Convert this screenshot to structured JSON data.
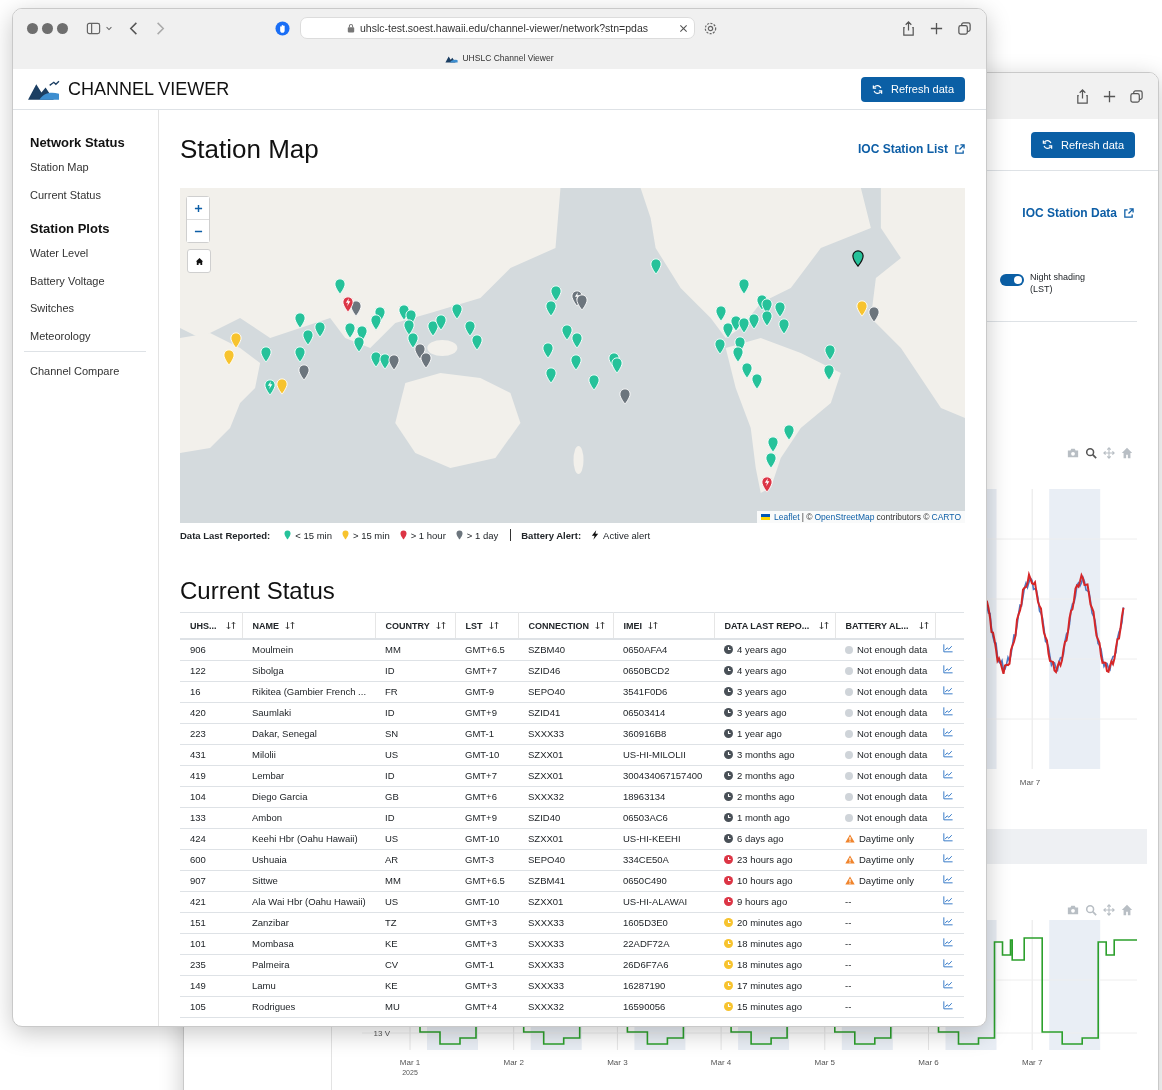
{
  "back_window": {
    "refresh_button": "Refresh data",
    "link": "IOC Station Data",
    "night_shading": {
      "label": "Night shading (LST)",
      "on": true
    },
    "chart1": {
      "xtick": "Mar 7"
    },
    "chart2": {
      "ytick": "13 V",
      "xticks": [
        "Mar 1",
        "Mar 2",
        "Mar 3",
        "Mar 4",
        "Mar 5",
        "Mar 6",
        "Mar 7"
      ],
      "year": "2025"
    }
  },
  "front_window": {
    "url": "uhslc-test.soest.hawaii.edu/channel-viewer/network?stn=pdas",
    "tab_title": "UHSLC Channel Viewer",
    "app_title": "CHANNEL VIEWER",
    "refresh_button": "Refresh data",
    "sidebar": {
      "sections": [
        {
          "heading": "Network Status",
          "items": [
            {
              "label": "Station Map",
              "selected": false
            },
            {
              "label": "Current Status",
              "selected": false
            }
          ]
        },
        {
          "heading": "Station Plots",
          "items": [
            {
              "label": "Water Level",
              "selected": false
            },
            {
              "label": "Battery Voltage",
              "selected": false
            },
            {
              "label": "Switches",
              "selected": false
            },
            {
              "label": "Meteorology",
              "selected": false
            }
          ]
        }
      ],
      "footer_items": [
        {
          "label": "Channel Compare",
          "selected": false
        }
      ]
    },
    "map_section": {
      "title": "Station Map",
      "link": "IOC Station List",
      "attribution": {
        "leaflet": "Leaflet",
        "middle": "| ©",
        "osm": "OpenStreetMap",
        "rest": "contributors ©",
        "carto": "CARTO"
      },
      "legend": {
        "title": "Data Last Reported:",
        "items": [
          {
            "label": "< 15 min",
            "color": "#26c29a"
          },
          {
            "label": "> 15 min",
            "color": "#f7c32e"
          },
          {
            "label": "> 1 hour",
            "color": "#dc3545"
          },
          {
            "label": "> 1 day",
            "color": "#6c757d"
          }
        ],
        "battery_title": "Battery Alert:",
        "battery_label": "Active alert"
      },
      "markers": [
        {
          "color": "#26c29a",
          "alert": false,
          "selected": false
        },
        {
          "color": "#26c29a",
          "alert": false,
          "selected": false
        },
        {
          "color": "#26c29a",
          "alert": false,
          "selected": false
        },
        {
          "color": "#26c29a",
          "alert": false,
          "selected": false
        },
        {
          "color": "#26c29a",
          "alert": false,
          "selected": false
        },
        {
          "color": "#26c29a",
          "alert": false,
          "selected": false
        },
        {
          "color": "#26c29a",
          "alert": false,
          "selected": false
        },
        {
          "color": "#26c29a",
          "alert": false,
          "selected": false
        },
        {
          "color": "#26c29a",
          "alert": false,
          "selected": false
        },
        {
          "color": "#26c29a",
          "alert": false,
          "selected": false
        },
        {
          "color": "#26c29a",
          "alert": false,
          "selected": false
        },
        {
          "color": "#26c29a",
          "alert": false,
          "selected": false
        },
        {
          "color": "#26c29a",
          "alert": false,
          "selected": false
        },
        {
          "color": "#26c29a",
          "alert": false,
          "selected": false
        },
        {
          "color": "#26c29a",
          "alert": false,
          "selected": false
        },
        {
          "color": "#26c29a",
          "alert": false,
          "selected": false
        },
        {
          "color": "#26c29a",
          "alert": false,
          "selected": false
        },
        {
          "color": "#26c29a",
          "alert": false,
          "selected": false
        },
        {
          "color": "#26c29a",
          "alert": false,
          "selected": false
        },
        {
          "color": "#26c29a",
          "alert": false,
          "selected": false
        },
        {
          "color": "#26c29a",
          "alert": false,
          "selected": false
        },
        {
          "color": "#26c29a",
          "alert": false,
          "selected": false
        },
        {
          "color": "#26c29a",
          "alert": true,
          "selected": false
        },
        {
          "color": "#26c29a",
          "alert": false,
          "selected": false
        },
        {
          "color": "#26c29a",
          "alert": false,
          "selected": false
        },
        {
          "color": "#26c29a",
          "alert": false,
          "selected": false
        },
        {
          "color": "#26c29a",
          "alert": false,
          "selected": false
        },
        {
          "color": "#26c29a",
          "alert": false,
          "selected": false
        },
        {
          "color": "#26c29a",
          "alert": false,
          "selected": false
        },
        {
          "color": "#26c29a",
          "alert": false,
          "selected": false
        },
        {
          "color": "#26c29a",
          "alert": false,
          "selected": false
        },
        {
          "color": "#26c29a",
          "alert": false,
          "selected": false
        },
        {
          "color": "#26c29a",
          "alert": false,
          "selected": false
        },
        {
          "color": "#26c29a",
          "alert": false,
          "selected": false
        },
        {
          "color": "#26c29a",
          "alert": false,
          "selected": false
        },
        {
          "color": "#26c29a",
          "alert": false,
          "selected": false
        },
        {
          "color": "#26c29a",
          "alert": false,
          "selected": false
        },
        {
          "color": "#26c29a",
          "alert": false,
          "selected": false
        },
        {
          "color": "#26c29a",
          "alert": false,
          "selected": false
        },
        {
          "color": "#26c29a",
          "alert": false,
          "selected": false
        },
        {
          "color": "#26c29a",
          "alert": false,
          "selected": false
        },
        {
          "color": "#26c29a",
          "alert": false,
          "selected": false
        },
        {
          "color": "#26c29a",
          "alert": false,
          "selected": false
        },
        {
          "color": "#26c29a",
          "alert": false,
          "selected": false
        },
        {
          "color": "#26c29a",
          "alert": false,
          "selected": false
        },
        {
          "color": "#26c29a",
          "alert": false,
          "selected": false
        },
        {
          "color": "#26c29a",
          "alert": false,
          "selected": false
        },
        {
          "color": "#26c29a",
          "alert": false,
          "selected": false
        },
        {
          "color": "#26c29a",
          "alert": false,
          "selected": false
        },
        {
          "color": "#26c29a",
          "alert": false,
          "selected": false
        },
        {
          "color": "#26c29a",
          "alert": false,
          "selected": false
        },
        {
          "color": "#26c29a",
          "alert": false,
          "selected": false
        },
        {
          "color": "#26c29a",
          "alert": false,
          "selected": false
        },
        {
          "color": "#26c29a",
          "alert": false,
          "selected": false
        },
        {
          "color": "#26c29a",
          "alert": false,
          "selected": false
        },
        {
          "color": "#26c29a",
          "alert": false,
          "selected": true
        },
        {
          "color": "#f7c32e",
          "alert": false,
          "selected": false
        },
        {
          "color": "#f7c32e",
          "alert": false,
          "selected": false
        },
        {
          "color": "#f7c32e",
          "alert": false,
          "selected": false
        },
        {
          "color": "#f7c32e",
          "alert": false,
          "selected": false
        },
        {
          "color": "#6c757d",
          "alert": false,
          "selected": false
        },
        {
          "color": "#6c757d",
          "alert": false,
          "selected": false
        },
        {
          "color": "#6c757d",
          "alert": false,
          "selected": false
        },
        {
          "color": "#6c757d",
          "alert": false,
          "selected": false
        },
        {
          "color": "#6c757d",
          "alert": false,
          "selected": false
        },
        {
          "color": "#6c757d",
          "alert": true,
          "selected": false
        },
        {
          "color": "#6c757d",
          "alert": false,
          "selected": false
        },
        {
          "color": "#6c757d",
          "alert": false,
          "selected": false
        },
        {
          "color": "#6c757d",
          "alert": false,
          "selected": false
        },
        {
          "color": "#dc3545",
          "alert": true,
          "selected": false
        },
        {
          "color": "#dc3545",
          "alert": true,
          "selected": false
        }
      ]
    },
    "status_section": {
      "title": "Current Status",
      "columns": [
        "UHS...",
        "NAME",
        "COUNTRY",
        "LST",
        "CONNECTION",
        "IMEI",
        "DATA LAST REPO...",
        "BATTERY AL..."
      ],
      "rows": [
        {
          "id": "906",
          "name": "Moulmein",
          "country": "MM",
          "lst": "GMT+6.5",
          "connection": "SZBM40",
          "imei": "0650AFA4",
          "last_report": "4 years ago",
          "color": "#495057",
          "battery": {
            "text": "Not enough data",
            "kind": "no_data"
          }
        },
        {
          "id": "122",
          "name": "Sibolga",
          "country": "ID",
          "lst": "GMT+7",
          "connection": "SZID46",
          "imei": "0650BCD2",
          "last_report": "4 years ago",
          "color": "#495057",
          "battery": {
            "text": "Not enough data",
            "kind": "no_data"
          }
        },
        {
          "id": "16",
          "name": "Rikitea (Gambier French ...",
          "country": "FR",
          "lst": "GMT-9",
          "connection": "SEPO40",
          "imei": "3541F0D6",
          "last_report": "3 years ago",
          "color": "#495057",
          "battery": {
            "text": "Not enough data",
            "kind": "no_data"
          }
        },
        {
          "id": "420",
          "name": "Saumlaki",
          "country": "ID",
          "lst": "GMT+9",
          "connection": "SZID41",
          "imei": "06503414",
          "last_report": "3 years ago",
          "color": "#495057",
          "battery": {
            "text": "Not enough data",
            "kind": "no_data"
          }
        },
        {
          "id": "223",
          "name": "Dakar, Senegal",
          "country": "SN",
          "lst": "GMT-1",
          "connection": "SXXX33",
          "imei": "360916B8",
          "last_report": "1 year ago",
          "color": "#495057",
          "battery": {
            "text": "Not enough data",
            "kind": "no_data"
          }
        },
        {
          "id": "431",
          "name": "Milolii",
          "country": "US",
          "lst": "GMT-10",
          "connection": "SZXX01",
          "imei": "US-HI-MILOLII",
          "last_report": "3 months ago",
          "color": "#495057",
          "battery": {
            "text": "Not enough data",
            "kind": "no_data"
          }
        },
        {
          "id": "419",
          "name": "Lembar",
          "country": "ID",
          "lst": "GMT+7",
          "connection": "SZXX01",
          "imei": "300434067157400",
          "last_report": "2 months ago",
          "color": "#495057",
          "battery": {
            "text": "Not enough data",
            "kind": "no_data"
          }
        },
        {
          "id": "104",
          "name": "Diego Garcia",
          "country": "GB",
          "lst": "GMT+6",
          "connection": "SXXX32",
          "imei": "18963134",
          "last_report": "2 months ago",
          "color": "#495057",
          "battery": {
            "text": "Not enough data",
            "kind": "no_data"
          }
        },
        {
          "id": "133",
          "name": "Ambon",
          "country": "ID",
          "lst": "GMT+9",
          "connection": "SZID40",
          "imei": "06503AC6",
          "last_report": "1 month ago",
          "color": "#495057",
          "battery": {
            "text": "Not enough data",
            "kind": "no_data"
          }
        },
        {
          "id": "424",
          "name": "Keehi Hbr (Oahu Hawaii)",
          "country": "US",
          "lst": "GMT-10",
          "connection": "SZXX01",
          "imei": "US-HI-KEEHI",
          "last_report": "6 days ago",
          "color": "#495057",
          "battery": {
            "text": "Daytime only",
            "kind": "warning"
          }
        },
        {
          "id": "600",
          "name": "Ushuaia",
          "country": "AR",
          "lst": "GMT-3",
          "connection": "SEPO40",
          "imei": "334CE50A",
          "last_report": "23 hours ago",
          "color": "#dc3545",
          "battery": {
            "text": "Daytime only",
            "kind": "warning"
          }
        },
        {
          "id": "907",
          "name": "Sittwe",
          "country": "MM",
          "lst": "GMT+6.5",
          "connection": "SZBM41",
          "imei": "0650C490",
          "last_report": "10 hours ago",
          "color": "#dc3545",
          "battery": {
            "text": "Daytime only",
            "kind": "warning"
          }
        },
        {
          "id": "421",
          "name": "Ala Wai Hbr (Oahu Hawaii)",
          "country": "US",
          "lst": "GMT-10",
          "connection": "SZXX01",
          "imei": "US-HI-ALAWAI",
          "last_report": "9 hours ago",
          "color": "#dc3545",
          "battery": {
            "text": "--",
            "kind": "none"
          }
        },
        {
          "id": "151",
          "name": "Zanzibar",
          "country": "TZ",
          "lst": "GMT+3",
          "connection": "SXXX33",
          "imei": "1605D3E0",
          "last_report": "20 minutes ago",
          "color": "#f7c32e",
          "battery": {
            "text": "--",
            "kind": "none"
          }
        },
        {
          "id": "101",
          "name": "Mombasa",
          "country": "KE",
          "lst": "GMT+3",
          "connection": "SXXX33",
          "imei": "22ADF72A",
          "last_report": "18 minutes ago",
          "color": "#f7c32e",
          "battery": {
            "text": "--",
            "kind": "none"
          }
        },
        {
          "id": "235",
          "name": "Palmeira",
          "country": "CV",
          "lst": "GMT-1",
          "connection": "SXXX33",
          "imei": "26D6F7A6",
          "last_report": "18 minutes ago",
          "color": "#f7c32e",
          "battery": {
            "text": "--",
            "kind": "none"
          }
        },
        {
          "id": "149",
          "name": "Lamu",
          "country": "KE",
          "lst": "GMT+3",
          "connection": "SXXX33",
          "imei": "16287190",
          "last_report": "17 minutes ago",
          "color": "#f7c32e",
          "battery": {
            "text": "--",
            "kind": "none"
          }
        },
        {
          "id": "105",
          "name": "Rodrigues",
          "country": "MU",
          "lst": "GMT+4",
          "connection": "SXXX32",
          "imei": "16590056",
          "last_report": "15 minutes ago",
          "color": "#f7c32e",
          "battery": {
            "text": "--",
            "kind": "none"
          }
        }
      ]
    }
  }
}
